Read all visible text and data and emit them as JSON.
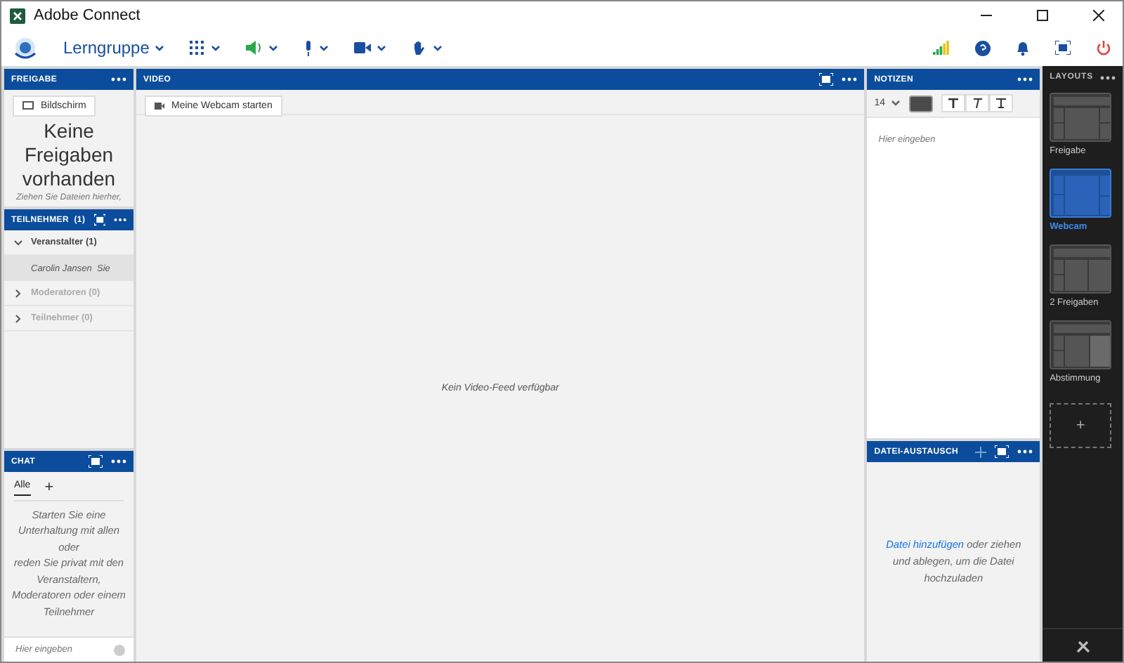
{
  "window": {
    "title": "Adobe Connect"
  },
  "toolbar": {
    "room": "Lerngruppe"
  },
  "freigabe": {
    "title": "FREIGABE",
    "button": "Bildschirm",
    "empty_title": "Keine Freigaben vorhanden",
    "hint": "Ziehen Sie Dateien hierher,"
  },
  "teilnehmer": {
    "title": "TEILNEHMER",
    "count": "(1)",
    "groups": [
      {
        "label": "Veranstalter (1)",
        "expanded": true,
        "children": [
          {
            "name": "Carolin Jansen",
            "suffix": "Sie"
          }
        ]
      },
      {
        "label": "Moderatoren (0)",
        "expanded": false
      },
      {
        "label": "Teilnehmer (0)",
        "expanded": false
      }
    ]
  },
  "chat": {
    "title": "CHAT",
    "tabs": [
      {
        "label": "Alle",
        "selected": true
      }
    ],
    "add": "+",
    "message": "Starten Sie eine Unterhaltung mit allen oder\nreden Sie privat mit den Veranstaltern, Moderatoren oder einem Teilnehmer",
    "placeholder": "Hier eingeben"
  },
  "video": {
    "title": "VIDEO",
    "button": "Meine Webcam starten",
    "empty": "Kein Video-Feed verfügbar"
  },
  "notizen": {
    "title": "NOTIZEN",
    "font_size": "14",
    "placeholder": "Hier eingeben"
  },
  "datei": {
    "title": "DATEI-AUSTAUSCH",
    "link": "Datei hinzufügen",
    "text": "oder ziehen und ablegen, um die Datei hochzuladen"
  },
  "layouts": {
    "title": "LAYOUTS",
    "items": [
      {
        "label": "Freigabe",
        "kind": "share",
        "selected": false
      },
      {
        "label": "Webcam",
        "kind": "webcam",
        "selected": true
      },
      {
        "label": "2 Freigaben",
        "kind": "two",
        "selected": false
      },
      {
        "label": "Abstimmung",
        "kind": "poll",
        "selected": false
      }
    ],
    "add": "+"
  }
}
